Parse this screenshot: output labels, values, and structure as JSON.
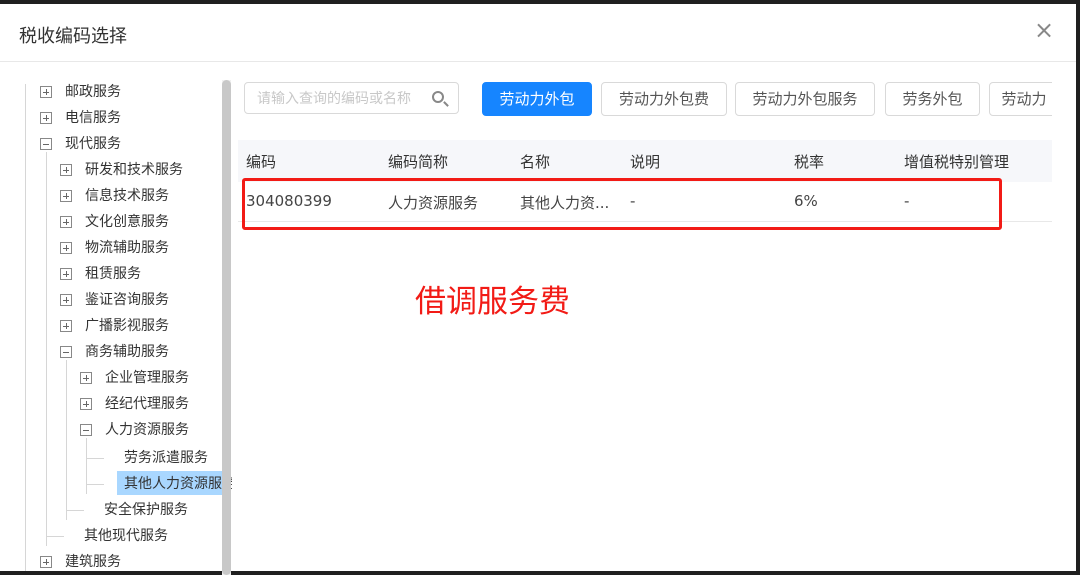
{
  "dialog": {
    "title": "税收编码选择",
    "close_symbol": "×"
  },
  "tree": {
    "items": [
      {
        "label": "邮政服务",
        "toggle": "plus"
      },
      {
        "label": "电信服务",
        "toggle": "plus"
      },
      {
        "label": "现代服务",
        "toggle": "minus"
      },
      {
        "label": "研发和技术服务",
        "toggle": "plus"
      },
      {
        "label": "信息技术服务",
        "toggle": "plus"
      },
      {
        "label": "文化创意服务",
        "toggle": "plus"
      },
      {
        "label": "物流辅助服务",
        "toggle": "plus"
      },
      {
        "label": "租赁服务",
        "toggle": "plus"
      },
      {
        "label": "鉴证咨询服务",
        "toggle": "plus"
      },
      {
        "label": "广播影视服务",
        "toggle": "plus"
      },
      {
        "label": "商务辅助服务",
        "toggle": "minus"
      },
      {
        "label": "企业管理服务",
        "toggle": "plus"
      },
      {
        "label": "经纪代理服务",
        "toggle": "plus"
      },
      {
        "label": "人力资源服务",
        "toggle": "minus"
      },
      {
        "label": "劳务派遣服务",
        "toggle": "none"
      },
      {
        "label": "其他人力资源服务",
        "toggle": "none",
        "selected": true
      },
      {
        "label": "安全保护服务",
        "toggle": "none"
      },
      {
        "label": "其他现代服务",
        "toggle": "none"
      },
      {
        "label": "建筑服务",
        "toggle": "plus"
      }
    ]
  },
  "search": {
    "placeholder": "请输入查询的编码或名称",
    "value": ""
  },
  "chips": [
    {
      "label": "劳动力外包",
      "active": true
    },
    {
      "label": "劳动力外包费",
      "active": false
    },
    {
      "label": "劳动力外包服务",
      "active": false
    },
    {
      "label": "劳务外包",
      "active": false
    },
    {
      "label": "劳动力",
      "active": false
    }
  ],
  "table": {
    "headers": [
      "编码",
      "编码简称",
      "名称",
      "说明",
      "税率",
      "增值税特别管理"
    ],
    "rows": [
      [
        "304080399",
        "人力资源服务",
        "其他人力资...",
        "-",
        "6%",
        "-"
      ]
    ]
  },
  "annotation": {
    "text": "借调服务费",
    "color": "#f21b16"
  },
  "colors": {
    "primary": "#1685ff",
    "selected_tree": "#a9d7ff",
    "annotation_red": "#f21b16"
  }
}
